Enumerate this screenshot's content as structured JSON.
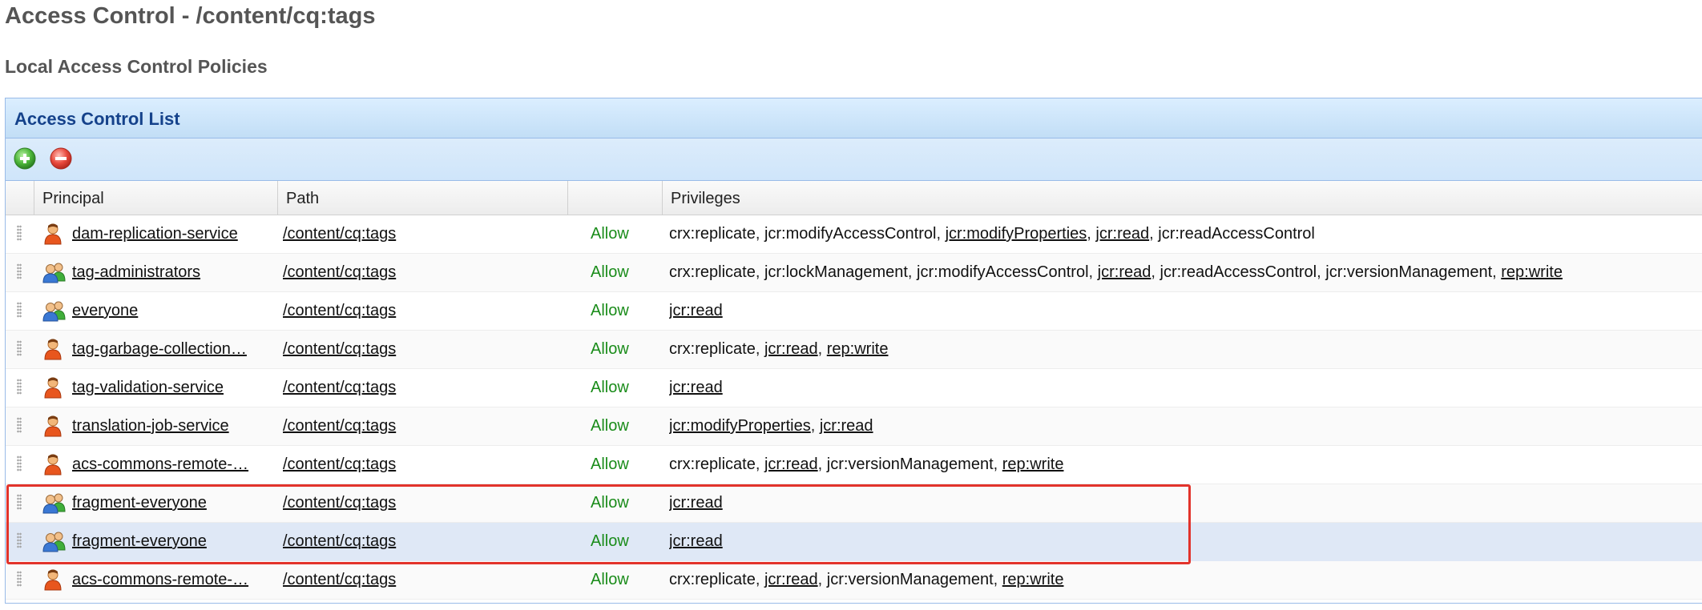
{
  "page_title": "Access Control - /content/cq:tags",
  "section_title": "Local Access Control Policies",
  "panel": {
    "title": "Access Control List",
    "toolbar": {
      "add_icon": "add-icon",
      "remove_icon": "remove-icon"
    },
    "columns": {
      "principal": "Principal",
      "path": "Path",
      "allow": "",
      "privileges": "Privileges"
    },
    "rows": [
      {
        "principal": "dam-replication-service",
        "principal_type": "user",
        "path": "/content/cq:tags",
        "access": "Allow",
        "privileges": [
          {
            "text": "crx:replicate",
            "link": false
          },
          {
            "text": "jcr:modifyAccessControl",
            "link": false
          },
          {
            "text": "jcr:modifyProperties",
            "link": true
          },
          {
            "text": "jcr:read",
            "link": true
          },
          {
            "text": "jcr:readAccessControl",
            "link": false
          }
        ]
      },
      {
        "principal": "tag-administrators",
        "principal_type": "group",
        "path": "/content/cq:tags",
        "access": "Allow",
        "privileges": [
          {
            "text": "crx:replicate",
            "link": false
          },
          {
            "text": "jcr:lockManagement",
            "link": false
          },
          {
            "text": "jcr:modifyAccessControl",
            "link": false
          },
          {
            "text": "jcr:read",
            "link": true
          },
          {
            "text": "jcr:readAccessControl",
            "link": false
          },
          {
            "text": "jcr:versionManagement",
            "link": false
          },
          {
            "text": "rep:write",
            "link": true
          }
        ]
      },
      {
        "principal": "everyone",
        "principal_type": "group",
        "path": "/content/cq:tags",
        "access": "Allow",
        "privileges": [
          {
            "text": "jcr:read",
            "link": true
          }
        ]
      },
      {
        "principal": "tag-garbage-collection…",
        "principal_type": "user",
        "path": "/content/cq:tags",
        "access": "Allow",
        "privileges": [
          {
            "text": "crx:replicate",
            "link": false
          },
          {
            "text": "jcr:read",
            "link": true
          },
          {
            "text": "rep:write",
            "link": true
          }
        ]
      },
      {
        "principal": "tag-validation-service",
        "principal_type": "user",
        "path": "/content/cq:tags",
        "access": "Allow",
        "privileges": [
          {
            "text": "jcr:read",
            "link": true
          }
        ]
      },
      {
        "principal": "translation-job-service",
        "principal_type": "user",
        "path": "/content/cq:tags",
        "access": "Allow",
        "privileges": [
          {
            "text": "jcr:modifyProperties",
            "link": true
          },
          {
            "text": "jcr:read",
            "link": true
          }
        ]
      },
      {
        "principal": "acs-commons-remote-…",
        "principal_type": "user",
        "path": "/content/cq:tags",
        "access": "Allow",
        "privileges": [
          {
            "text": "crx:replicate",
            "link": false
          },
          {
            "text": "jcr:read",
            "link": true
          },
          {
            "text": "jcr:versionManagement",
            "link": false
          },
          {
            "text": "rep:write",
            "link": true
          }
        ]
      },
      {
        "principal": "fragment-everyone",
        "principal_type": "group",
        "path": "/content/cq:tags",
        "access": "Allow",
        "privileges": [
          {
            "text": "jcr:read",
            "link": true
          }
        ]
      },
      {
        "principal": "fragment-everyone",
        "principal_type": "group",
        "path": "/content/cq:tags",
        "access": "Allow",
        "selected": true,
        "privileges": [
          {
            "text": "jcr:read",
            "link": true
          }
        ]
      },
      {
        "principal": "acs-commons-remote-…",
        "principal_type": "user",
        "path": "/content/cq:tags",
        "access": "Allow",
        "privileges": [
          {
            "text": "crx:replicate",
            "link": false
          },
          {
            "text": "jcr:read",
            "link": true
          },
          {
            "text": "jcr:versionManagement",
            "link": false
          },
          {
            "text": "rep:write",
            "link": true
          }
        ]
      }
    ]
  },
  "colors": {
    "allow": "#1a8c1a",
    "panel_title": "#15428b",
    "highlight": "#e2332b",
    "selected_row": "#dfe8f6"
  }
}
